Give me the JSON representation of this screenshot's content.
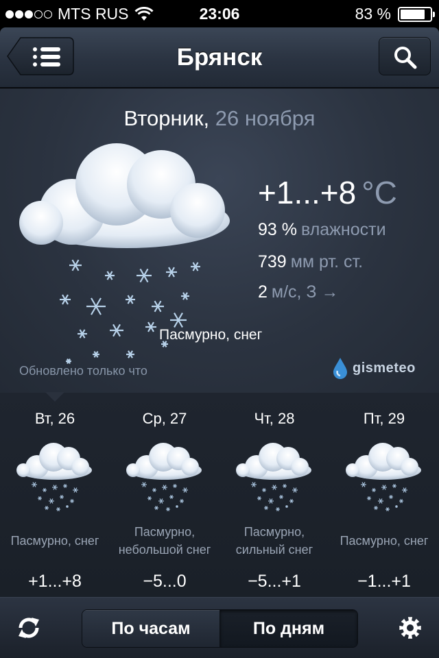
{
  "status_bar": {
    "signal_dots_filled": 3,
    "signal_dots_total": 5,
    "carrier": "MTS RUS",
    "wifi_icon": "wifi-icon",
    "time": "23:06",
    "battery_percent_text": "83 %",
    "battery_level": 0.83
  },
  "header": {
    "city": "Брянск",
    "menu_icon": "list-icon",
    "search_icon": "search-icon"
  },
  "current": {
    "weekday": "Вторник,",
    "date": "26 ноября",
    "temperature": "+1...+8",
    "temperature_unit": "°C",
    "humidity_value": "93 %",
    "humidity_label": "влажности",
    "pressure_value": "739",
    "pressure_label": "мм рт. ст.",
    "wind_value": "2",
    "wind_label": "м/с, З →",
    "condition": "Пасмурно, снег",
    "weather_icon": "cloud-snow-icon",
    "updated": "Обновлено только что",
    "provider": "gismeteo"
  },
  "forecast": [
    {
      "day": "Вт, 26",
      "condition": "Пасмурно, снег",
      "temp": "+1...+8",
      "icon": "cloud-snow-icon"
    },
    {
      "day": "Ср, 27",
      "condition": "Пасмурно,\nнебольшой снег",
      "temp": "−5...0",
      "icon": "cloud-snow-icon"
    },
    {
      "day": "Чт, 28",
      "condition": "Пасмурно,\nсильный снег",
      "temp": "−5...+1",
      "icon": "cloud-snow-icon"
    },
    {
      "day": "Пт, 29",
      "condition": "Пасмурно, снег",
      "temp": "−1...+1",
      "icon": "cloud-snow-icon"
    }
  ],
  "bottom_bar": {
    "refresh_icon": "refresh-icon",
    "tab_hourly": "По часам",
    "tab_daily": "По дням",
    "selected_tab": "По дням",
    "settings_icon": "gear-icon"
  }
}
